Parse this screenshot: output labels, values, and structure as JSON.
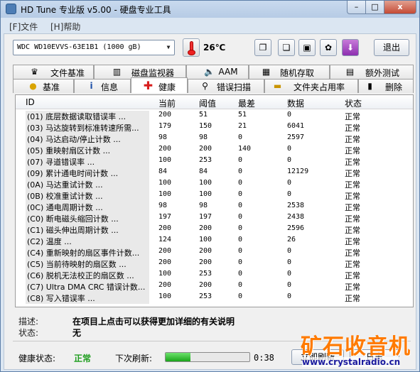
{
  "window": {
    "title": "HD Tune 专业版 v5.00 - 硬盘专业工具",
    "controls": {
      "minimize": "–",
      "maximize": "□",
      "close": "x"
    }
  },
  "menu": {
    "file": "[F]文件",
    "help": "[H]帮助"
  },
  "toolbar": {
    "drive": "WDC WD10EVVS-63E1B1      (1000 gB)",
    "temperature": "26℃",
    "exit_label": "退出",
    "icons": [
      "copy-icon",
      "copy-all-icon",
      "save-icon",
      "options-icon",
      "download-icon"
    ]
  },
  "tabs_top": [
    {
      "label": "文件基准",
      "icon": "file-benchmark-icon"
    },
    {
      "label": "磁盘监视器",
      "icon": "disk-monitor-icon"
    },
    {
      "label": "AAM",
      "icon": "speaker-icon"
    },
    {
      "label": "随机存取",
      "icon": "random-access-icon"
    },
    {
      "label": "额外测试",
      "icon": "extra-tests-icon"
    }
  ],
  "tabs_bottom": [
    {
      "label": "基准",
      "icon": "benchmark-icon"
    },
    {
      "label": "信息",
      "icon": "info-icon"
    },
    {
      "label": "健康",
      "icon": "health-cross-icon",
      "active": true
    },
    {
      "label": "错误扫描",
      "icon": "error-scan-icon"
    },
    {
      "label": "文件夹占用率",
      "icon": "folder-icon"
    },
    {
      "label": "删除",
      "icon": "trash-icon"
    }
  ],
  "smart_table": {
    "columns": [
      "ID",
      "当前",
      "阈值",
      "最差",
      "数据",
      "状态"
    ],
    "rows": [
      {
        "id": "(01) 底层数据读取错误率        ...",
        "current": "200",
        "threshold": "51",
        "worst": "51",
        "data": "0",
        "status": "正常"
      },
      {
        "id": "(03) 马达旋转到标准转速所需...",
        "current": "179",
        "threshold": "150",
        "worst": "21",
        "data": "6041",
        "status": "正常"
      },
      {
        "id": "(04) 马达启动/停止计数        ...",
        "current": "98",
        "threshold": "98",
        "worst": "0",
        "data": "2597",
        "status": "正常"
      },
      {
        "id": "(05) 重映射扇区计数            ...",
        "current": "200",
        "threshold": "200",
        "worst": "140",
        "data": "0",
        "status": "正常"
      },
      {
        "id": "(07) 寻道错误率                ...",
        "current": "100",
        "threshold": "253",
        "worst": "0",
        "data": "0",
        "status": "正常"
      },
      {
        "id": "(09) 累计通电时间计数          ...",
        "current": "84",
        "threshold": "84",
        "worst": "0",
        "data": "12129",
        "status": "正常"
      },
      {
        "id": "(0A) 马达重试计数              ...",
        "current": "100",
        "threshold": "100",
        "worst": "0",
        "data": "0",
        "status": "正常"
      },
      {
        "id": "(0B) 校准重试计数              ...",
        "current": "100",
        "threshold": "100",
        "worst": "0",
        "data": "0",
        "status": "正常"
      },
      {
        "id": "(0C) 通电周期计数              ...",
        "current": "98",
        "threshold": "98",
        "worst": "0",
        "data": "2538",
        "status": "正常"
      },
      {
        "id": "(C0) 断电磁头缩回计数          ...",
        "current": "197",
        "threshold": "197",
        "worst": "0",
        "data": "2438",
        "status": "正常"
      },
      {
        "id": "(C1) 磁头伸出周期计数          ...",
        "current": "200",
        "threshold": "200",
        "worst": "0",
        "data": "2596",
        "status": "正常"
      },
      {
        "id": "(C2) 温度                      ...",
        "current": "124",
        "threshold": "100",
        "worst": "0",
        "data": "26",
        "status": "正常"
      },
      {
        "id": "(C4) 重新映射的扇区事件计数...",
        "current": "200",
        "threshold": "200",
        "worst": "0",
        "data": "0",
        "status": "正常"
      },
      {
        "id": "(C5) 当前待映射的扇区数        ...",
        "current": "200",
        "threshold": "200",
        "worst": "0",
        "data": "0",
        "status": "正常"
      },
      {
        "id": "(C6) 脱机无法校正的扇区数      ...",
        "current": "100",
        "threshold": "253",
        "worst": "0",
        "data": "0",
        "status": "正常"
      },
      {
        "id": "(C7) Ultra DMA CRC 错误计数...",
        "current": "200",
        "threshold": "200",
        "worst": "0",
        "data": "0",
        "status": "正常"
      },
      {
        "id": "(C8) 写入错误率                ...",
        "current": "100",
        "threshold": "253",
        "worst": "0",
        "data": "0",
        "status": "正常"
      }
    ]
  },
  "description": {
    "desc_label": "描述:",
    "desc_text": "在项目上点击可以获得更加详细的有关说明",
    "status_label": "状态:",
    "status_text": "无"
  },
  "footer": {
    "health_label": "健康状态:",
    "health_value": "正常",
    "refresh_label": "下次刷新:",
    "refresh_progress_percent": 30,
    "countdown": "0:38",
    "refresh_now_label": "立即刷新",
    "log_label": "日志"
  },
  "watermark": {
    "cn": "矿石收音机",
    "en": "www.crystalradio.cn"
  },
  "colors": {
    "health_ok": "#1e9d1e",
    "watermark_orange": "#ff7a00",
    "watermark_blue": "#1a1a9e"
  }
}
